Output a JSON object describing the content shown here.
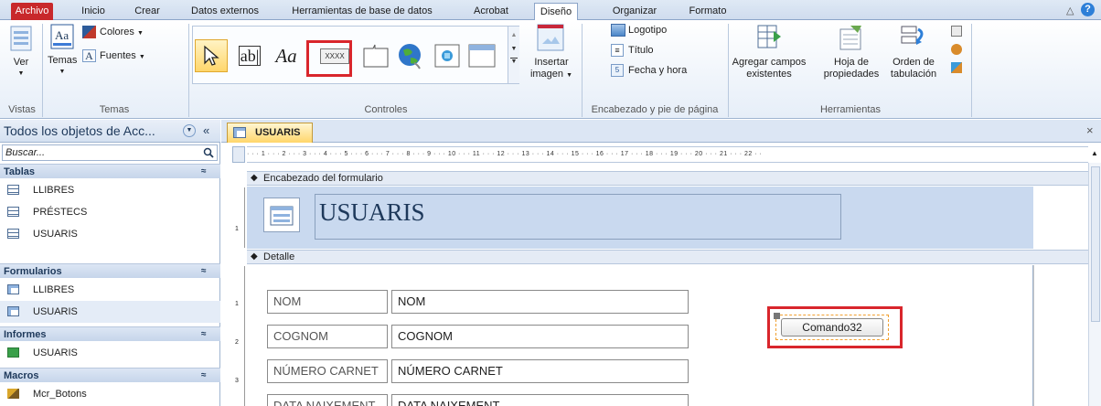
{
  "ribbon_tabs": {
    "file": "Archivo",
    "home": "Inicio",
    "create": "Crear",
    "external": "Datos externos",
    "dbtools": "Herramientas de base de datos",
    "acrobat": "Acrobat",
    "design": "Diseño",
    "arrange": "Organizar",
    "format": "Formato"
  },
  "ribbon": {
    "view_label": "Ver",
    "themes_label": "Temas",
    "colors_label": "Colores",
    "fonts_label": "Fuentes",
    "textbox_glyph": "ab|",
    "label_glyph": "Aa",
    "button_glyph": "XXXX",
    "insert_image": "Insertar",
    "insert_image_2": "imagen",
    "logo": "Logotipo",
    "title": "Título",
    "datetime": "Fecha y hora",
    "add_fields": "Agregar campos",
    "add_fields_2": "existentes",
    "property_sheet": "Hoja de",
    "property_sheet_2": "propiedades",
    "tab_order": "Orden de",
    "tab_order_2": "tabulación",
    "groups": {
      "views": "Vistas",
      "themes": "Temas",
      "controls": "Controles",
      "header_footer": "Encabezado y pie de página",
      "tools": "Herramientas"
    }
  },
  "nav": {
    "title": "Todos los objetos de Acc...",
    "search_placeholder": "Buscar...",
    "groups": [
      {
        "name": "Tablas",
        "items": [
          "LLIBRES",
          "PRÉSTECS",
          "USUARIS"
        ]
      },
      {
        "name": "Formularios",
        "items": [
          "LLIBRES",
          "USUARIS"
        ]
      },
      {
        "name": "Informes",
        "items": [
          "USUARIS"
        ]
      },
      {
        "name": "Macros",
        "items": [
          "Mcr_Botons"
        ]
      }
    ]
  },
  "document": {
    "tab_title": "USUARIS",
    "ruler_text": "· · · 1 · · · 2 · · · 3 · · · 4 · · · 5 · · · 6 · · · 7 · · · 8 · · · 9 · · · 10 · · · 11 · · · 12 · · · 13 · · · 14 · · · 15 · · · 16 · · · 17 · · · 18 · · · 19 · · · 20 · · · 21 · · · 22 · ·",
    "header_section": "Encabezado del formulario",
    "form_title": "USUARIS",
    "detail_section": "Detalle",
    "fields": [
      {
        "label": "NOM",
        "value": "NOM"
      },
      {
        "label": "COGNOM",
        "value": "COGNOM"
      },
      {
        "label": "NÚMERO CARNET",
        "value": "NÚMERO CARNET"
      },
      {
        "label": "DATA NAIXEMENT",
        "value": "DATA NAIXEMENT"
      }
    ],
    "command_button": "Comando32",
    "vruler_top": [
      "1"
    ],
    "vruler_detail": [
      "1",
      "2",
      "3"
    ]
  },
  "colors": {
    "accent_red": "#d9262c",
    "file_tab": "#c8282b",
    "selected_tool": "#ffd66b"
  }
}
